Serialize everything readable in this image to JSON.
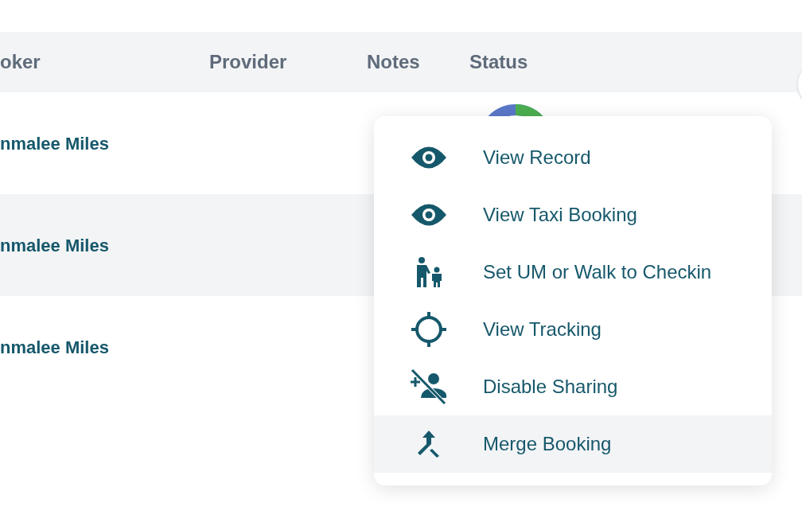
{
  "table": {
    "columns": [
      {
        "label": "oker"
      },
      {
        "label": "Provider"
      },
      {
        "label": "Notes"
      },
      {
        "label": "Status"
      }
    ],
    "rows": [
      {
        "booker": "nmalee Miles"
      },
      {
        "booker": "nmalee Miles"
      },
      {
        "booker": "nmalee Miles"
      }
    ]
  },
  "context_menu": {
    "items": [
      {
        "kind": "eye",
        "label": "View Record",
        "highlighted": false
      },
      {
        "kind": "eye",
        "label": "View Taxi Booking",
        "highlighted": false
      },
      {
        "kind": "walk",
        "label": "Set UM or Walk to Checkin",
        "highlighted": false
      },
      {
        "kind": "crosshair",
        "label": "View Tracking",
        "highlighted": false
      },
      {
        "kind": "no-share",
        "label": "Disable Sharing",
        "highlighted": false
      },
      {
        "kind": "merge",
        "label": "Merge Booking",
        "highlighted": true
      }
    ]
  }
}
